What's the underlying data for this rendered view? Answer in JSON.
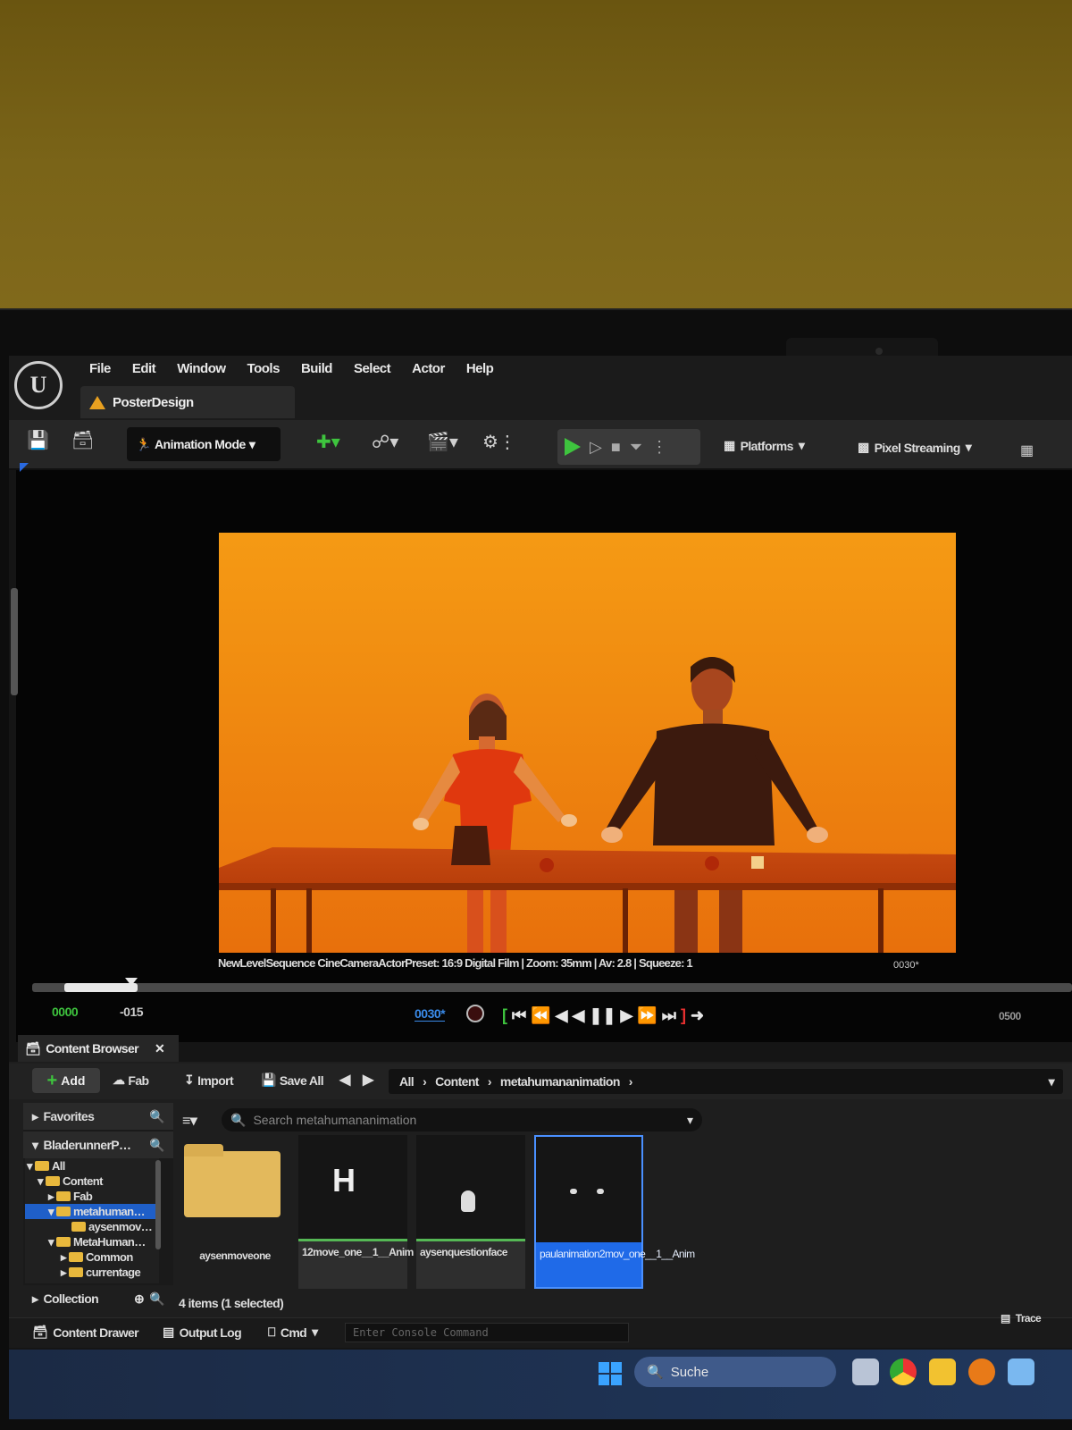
{
  "app": {
    "logo": "U",
    "menu": [
      "File",
      "Edit",
      "Window",
      "Tools",
      "Build",
      "Select",
      "Actor",
      "Help"
    ],
    "document_tab": "PosterDesign"
  },
  "toolbar": {
    "mode_label": "Animation Mode",
    "platforms_label": "Platforms",
    "pixel_streaming_label": "Pixel Streaming",
    "accent_play": "#3ec43e"
  },
  "viewport": {
    "caption": "NewLevelSequence CineCameraActorPreset: 16:9 Digital Film | Zoom: 35mm | Av: 2.8 | Squeeze: 1",
    "frame_top_right": "0030*"
  },
  "sequencer": {
    "start_frame": "0000",
    "offset_frame": "-015",
    "current_frame": "0030*",
    "end_frame": "0500",
    "playhead_fraction": 0.06
  },
  "content_browser": {
    "tab_label": "Content Browser",
    "add_label": "Add",
    "fab_label": "Fab",
    "import_label": "Import",
    "save_all_label": "Save All",
    "path": [
      "All",
      "Content",
      "metahumananimation"
    ],
    "favorites_label": "Favorites",
    "project_label": "BladerunnerP…",
    "collections_label": "Collection",
    "search_placeholder": "Search metahumananimation",
    "tree": [
      {
        "label": "All",
        "depth": 0
      },
      {
        "label": "Content",
        "depth": 1
      },
      {
        "label": "Fab",
        "depth": 2
      },
      {
        "label": "metahuman…",
        "depth": 2,
        "selected": true
      },
      {
        "label": "aysenmov…",
        "depth": 3
      },
      {
        "label": "MetaHuman…",
        "depth": 2
      },
      {
        "label": "Common",
        "depth": 3
      },
      {
        "label": "currentage",
        "depth": 3
      }
    ],
    "assets": [
      {
        "label": "aysenmoveone",
        "kind": "folder"
      },
      {
        "label": "12move_one__1__Anim",
        "kind": "anim"
      },
      {
        "label": "aysenquestionface",
        "kind": "anim"
      },
      {
        "label": "paulanimation2mov_one__1__Anim",
        "kind": "anim",
        "selected": true
      }
    ],
    "status": "4 items (1 selected)"
  },
  "bottom_bar": {
    "content_drawer": "Content Drawer",
    "output_log": "Output Log",
    "cmd": "Cmd",
    "console_placeholder": "Enter Console Command",
    "trace": "Trace"
  },
  "taskbar": {
    "search_label": "Suche"
  }
}
